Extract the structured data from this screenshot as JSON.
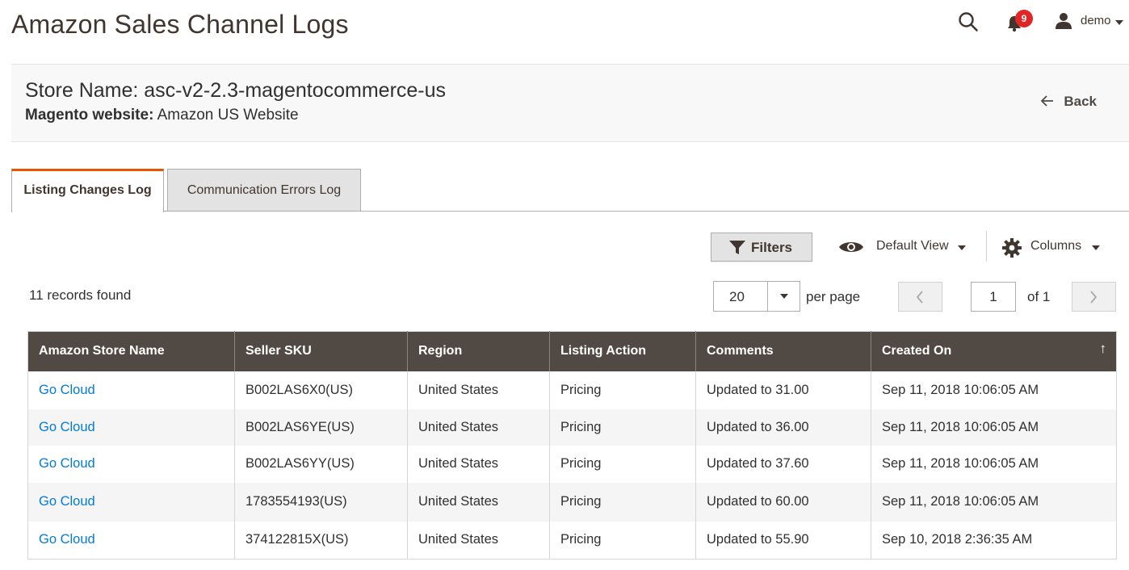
{
  "header": {
    "title": "Amazon Sales Channel Logs",
    "notifications_count": "9",
    "user_name": "demo"
  },
  "store": {
    "name": "Store Name: asc-v2-2.3-magentocommerce-us",
    "website_label": "Magento website:",
    "website_value": " Amazon US Website",
    "back_label": "Back"
  },
  "tabs": [
    {
      "label": "Listing Changes Log",
      "active": true
    },
    {
      "label": "Communication Errors Log",
      "active": false
    }
  ],
  "toolbar": {
    "filters_label": "Filters",
    "view_label": "Default View",
    "columns_label": "Columns"
  },
  "pagination": {
    "records_text": "11 records found",
    "per_page_value": "20",
    "per_page_label": "per page",
    "current_page": "1",
    "of_label": "of 1"
  },
  "table": {
    "columns": [
      "Amazon Store Name",
      "Seller SKU",
      "Region",
      "Listing Action",
      "Comments",
      "Created On"
    ],
    "sort_indicator": "↑",
    "rows": [
      {
        "store": "Go Cloud",
        "sku": "B002LAS6X0(US)",
        "region": "United States",
        "action": "Pricing",
        "comment": "Updated to 31.00",
        "created": "Sep 11, 2018 10:06:05 AM"
      },
      {
        "store": "Go Cloud",
        "sku": "B002LAS6YE(US)",
        "region": "United States",
        "action": "Pricing",
        "comment": "Updated to 36.00",
        "created": "Sep 11, 2018 10:06:05 AM"
      },
      {
        "store": "Go Cloud",
        "sku": "B002LAS6YY(US)",
        "region": "United States",
        "action": "Pricing",
        "comment": "Updated to 37.60",
        "created": "Sep 11, 2018 10:06:05 AM"
      },
      {
        "store": "Go Cloud",
        "sku": "1783554193(US)",
        "region": "United States",
        "action": "Pricing",
        "comment": "Updated to 60.00",
        "created": "Sep 11, 2018 10:06:05 AM"
      },
      {
        "store": "Go Cloud",
        "sku": "374122815X(US)",
        "region": "United States",
        "action": "Pricing",
        "comment": "Updated to 55.90",
        "created": "Sep 10, 2018 2:36:35 AM"
      }
    ]
  },
  "colors": {
    "accent": "#eb5202",
    "header_bg": "#514943",
    "link": "#007bdb",
    "badge": "#e22626"
  },
  "icons": [
    "search-icon",
    "bell-icon",
    "user-icon",
    "arrow-left-icon",
    "funnel-icon",
    "eye-icon",
    "gear-icon",
    "chevron-left-icon",
    "chevron-right-icon",
    "caret-down-icon"
  ]
}
